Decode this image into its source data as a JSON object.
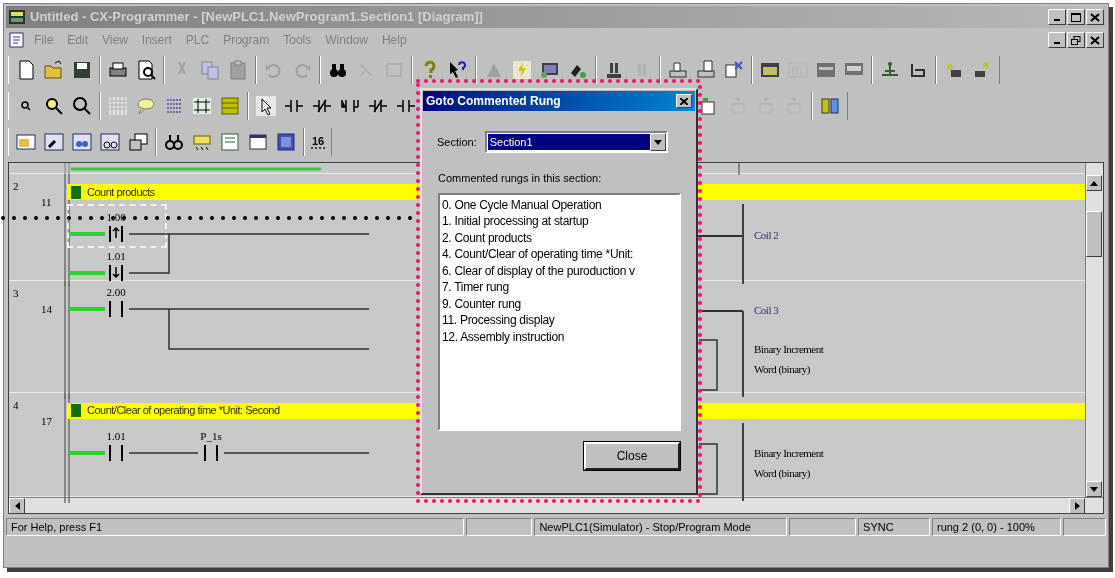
{
  "window": {
    "title": "Untitled - CX-Programmer - [NewPLC1.NewProgram1.Section1 [Diagram]]"
  },
  "menu": [
    "File",
    "Edit",
    "View",
    "Insert",
    "PLC",
    "Program",
    "Tools",
    "Window",
    "Help"
  ],
  "toolbar_badge": "16",
  "rungs": [
    {
      "number": "2",
      "step": "11",
      "comment": "Count products",
      "contacts": [
        {
          "address": "1.00",
          "kind": "up",
          "cursor": true
        },
        {
          "address": "1.01",
          "kind": "down",
          "cursor": false
        }
      ],
      "outputs": [
        {
          "kind": "coil",
          "text": "Coil 2"
        }
      ]
    },
    {
      "number": "3",
      "step": "14",
      "contacts": [
        {
          "address": "2.00",
          "kind": "open",
          "cursor": false
        }
      ],
      "outputs": [
        {
          "kind": "coil",
          "text": "Coil 3"
        },
        {
          "kind": "instruction",
          "text": "Binary Increment",
          "sub": "Word (binary)"
        }
      ]
    },
    {
      "number": "4",
      "step": "17",
      "comment": "Count/Clear of operating time *Unit: Second",
      "contacts": [
        {
          "address": "1.01",
          "kind": "open",
          "cursor": false
        },
        {
          "address": "P_1s",
          "kind": "open",
          "cursor": false
        }
      ],
      "outputs": [
        {
          "kind": "instruction",
          "text": "Binary Increment",
          "sub": "Word (binary)"
        }
      ]
    }
  ],
  "dialog": {
    "title": "Goto Commented Rung",
    "section_label": "Section:",
    "section_value": "Section1",
    "list_label": "Commented rungs in this section:",
    "items": [
      {
        "text": "0. One Cycle Manual Operation",
        "selected": false
      },
      {
        "text": "1. Initial processing at startup",
        "selected": false
      },
      {
        "text": "2. Count products",
        "selected": false
      },
      {
        "text": "4. Count/Clear of operating time *Unit:",
        "selected": false
      },
      {
        "text": "6. Clear of display of the puroduction v",
        "selected": false
      },
      {
        "text": "7. Timer rung",
        "selected": false
      },
      {
        "text": "9. Counter rung",
        "selected": false
      },
      {
        "text": "11. Processing display",
        "selected": false
      },
      {
        "text": "12. Assembly instruction",
        "selected": false
      }
    ],
    "close": "Close"
  },
  "status_bar": [
    "For Help, press F1",
    "NewPLC1(Simulator) - Stop/Program Mode",
    "SYNC",
    "rung 2 (0, 0) - 100%"
  ]
}
